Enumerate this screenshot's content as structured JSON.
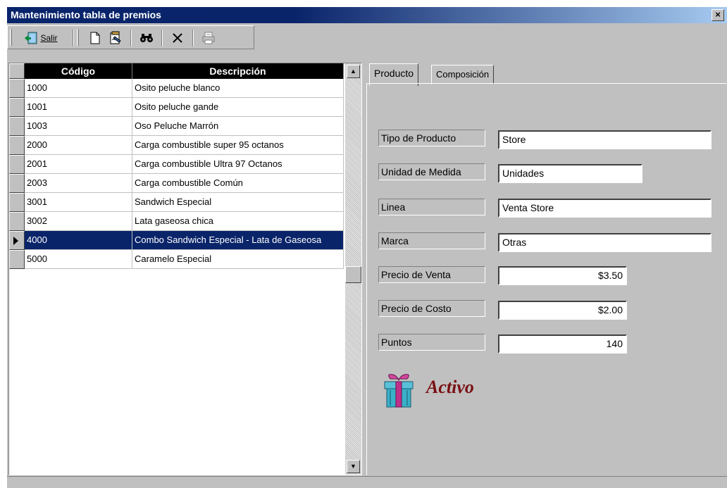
{
  "window": {
    "title": "Mantenimiento tabla de premios",
    "close_label": "×"
  },
  "toolbar": {
    "exit_label": "Salir",
    "buttons": [
      "exit",
      "new",
      "edit",
      "find",
      "delete",
      "print"
    ]
  },
  "grid": {
    "columns": [
      "Código",
      "Descripción"
    ],
    "rows": [
      {
        "code": "1000",
        "desc": "Osito peluche blanco"
      },
      {
        "code": "1001",
        "desc": "Osito peluche gande"
      },
      {
        "code": "1003",
        "desc": "Oso Peluche Marrón"
      },
      {
        "code": "2000",
        "desc": "Carga combustible super 95 octanos"
      },
      {
        "code": "2001",
        "desc": "Carga combustible Ultra 97 Octanos"
      },
      {
        "code": "2003",
        "desc": "Carga combustible Común"
      },
      {
        "code": "3001",
        "desc": "Sandwich Especial"
      },
      {
        "code": "3002",
        "desc": "Lata gaseosa chica"
      },
      {
        "code": "4000",
        "desc": "Combo Sandwich Especial - Lata de Gaseosa"
      },
      {
        "code": "5000",
        "desc": "Caramelo Especial"
      }
    ],
    "selected_index": 8
  },
  "tabs": [
    "Producto",
    "Composición"
  ],
  "form": {
    "tipo_label": "Tipo de Producto",
    "tipo_value": "Store",
    "unidad_label": "Unidad de Medida",
    "unidad_value": "Unidades",
    "linea_label": "Linea",
    "linea_value": "Venta Store",
    "marca_label": "Marca",
    "marca_value": "Otras",
    "precio_venta_label": "Precio de Venta",
    "precio_venta_value": "$3.50",
    "precio_costo_label": "Precio de Costo",
    "precio_costo_value": "$2.00",
    "puntos_label": "Puntos",
    "puntos_value": "140"
  },
  "status": {
    "label": "Activo",
    "icon": "gift-icon"
  },
  "colors": {
    "title_start": "#0a246a",
    "title_end": "#a6caf0",
    "selection": "#0a246a",
    "activo": "#7a0f12",
    "face": "#c0c0c0"
  }
}
